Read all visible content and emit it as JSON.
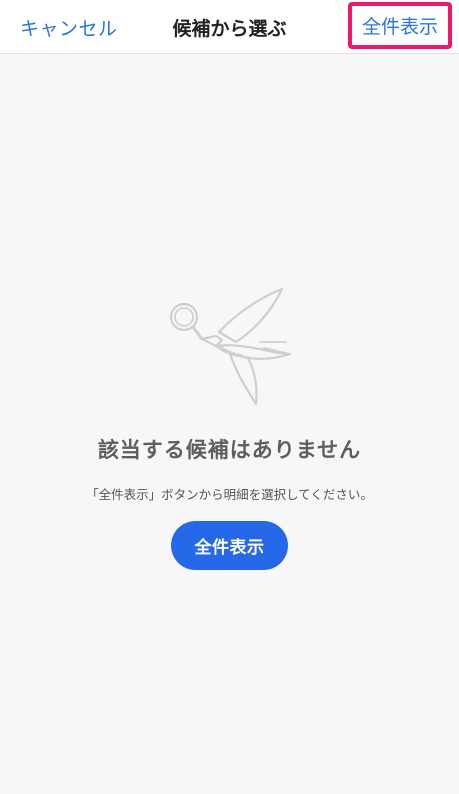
{
  "navbar": {
    "cancel_label": "キャンセル",
    "title": "候補から選ぶ",
    "show_all_label": "全件表示"
  },
  "empty_state": {
    "illustration_icon": "bird-with-magnifier-icon",
    "title": "該当する候補はありません",
    "description": "「全件表示」ボタンから明細を選択してください。",
    "button_label": "全件表示"
  },
  "colors": {
    "accent": "#2a73e6",
    "button": "#2568e8",
    "highlight_border": "#f0176b",
    "background": "#f7f6f8"
  }
}
